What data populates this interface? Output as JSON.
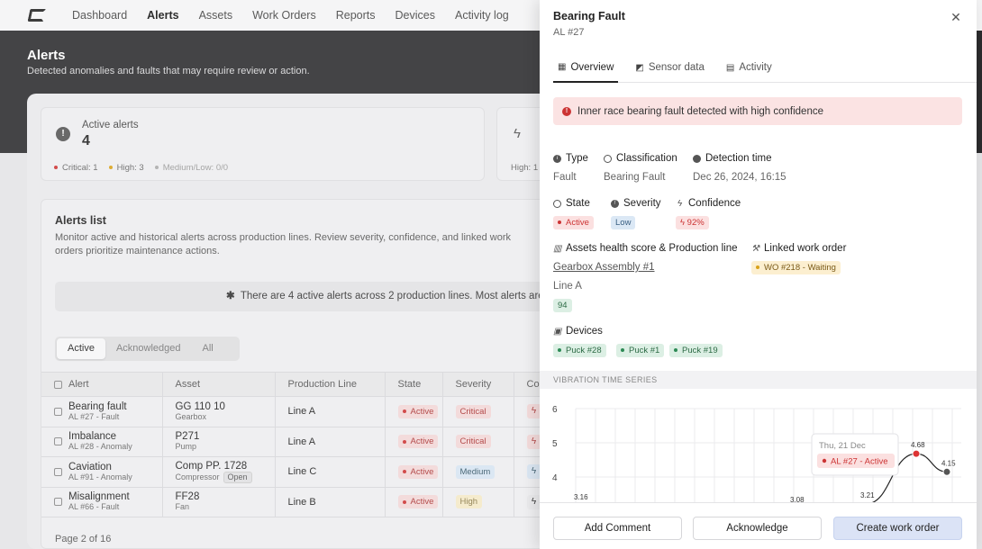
{
  "nav": {
    "items": [
      "Dashboard",
      "Alerts",
      "Assets",
      "Work Orders",
      "Reports",
      "Devices",
      "Activity log"
    ],
    "active": "Alerts"
  },
  "hero": {
    "title": "Alerts",
    "subtitle": "Detected anomalies and faults that may require review or action."
  },
  "stats": {
    "active_alerts": {
      "label": "Active alerts",
      "value": "4",
      "critical": "Critical: 1",
      "high": "High: 3",
      "medium_low": "Medium/Low: 0/0"
    },
    "second": {
      "text": "High: 1"
    }
  },
  "alerts_list": {
    "title": "Alerts list",
    "description": "Monitor active and historical alerts across production lines. Review severity, confidence, and linked work orders prioritize maintenance actions.",
    "banner": "There are 4 active alerts across 2 production lines. Most alerts are",
    "filters": [
      "Active",
      "Acknowledged",
      "All"
    ],
    "columns": [
      "Alert",
      "Asset",
      "Production Line",
      "State",
      "Severity",
      "Cor"
    ],
    "rows": [
      {
        "alert": "Bearing fault",
        "alert_sub": "AL #27 - Fault",
        "asset": "GG 110 10",
        "asset_sub": "Gearbox",
        "line": "Line A",
        "state": "Active",
        "severity": "Critical",
        "sev_class": "b-red"
      },
      {
        "alert": "Imbalance",
        "alert_sub": "AL #28 - Anomaly",
        "asset": "P271",
        "asset_sub": "Pump",
        "line": "Line A",
        "state": "Active",
        "severity": "Critical",
        "sev_class": "b-red"
      },
      {
        "alert": "Caviation",
        "alert_sub": "AL #91 - Anomaly",
        "asset": "Comp PP. 1728",
        "asset_sub": "Compressor",
        "line": "Line C",
        "state": "Active",
        "severity": "Medium",
        "sev_class": "b-blue"
      },
      {
        "alert": "Misalignment",
        "alert_sub": "AL #66 - Fault",
        "asset": "FF28",
        "asset_sub": "Fan",
        "line": "Line B",
        "state": "Active",
        "severity": "High",
        "sev_class": "b-yellow"
      }
    ],
    "open_label": "Open",
    "pager": "Page 2 of 16"
  },
  "drawer": {
    "title": "Bearing Fault",
    "subtitle": "AL #27",
    "tabs": [
      "Overview",
      "Sensor data",
      "Activity"
    ],
    "alert_message": "Inner race bearing fault detected with high confidence",
    "type_label": "Type",
    "type_value": "Fault",
    "classification_label": "Classification",
    "classification_value": "Bearing Fault",
    "detection_label": "Detection time",
    "detection_value": "Dec 26, 2024, 16:15",
    "state_label": "State",
    "state_value": "Active",
    "severity_label": "Severity",
    "severity_value": "Low",
    "confidence_label": "Confidence",
    "confidence_value": "92%",
    "health_label": "Assets health score & Production line",
    "health_asset": "Gearbox Assembly #1",
    "health_line": "Line A",
    "health_score": "94",
    "wo_label": "Linked work order",
    "wo_value": "WO #218 - Waiting",
    "devices_label": "Devices",
    "devices": [
      "Puck #28",
      "Puck #1",
      "Puck #19"
    ],
    "ts_title": "VIBRATION TIME SERIES",
    "buttons": {
      "comment": "Add Comment",
      "ack": "Acknowledge",
      "create": "Create work order"
    }
  },
  "chart_data": {
    "type": "line",
    "title": "VIBRATION TIME SERIES",
    "y_ticks": [
      4,
      5,
      6
    ],
    "ylim": [
      3,
      6
    ],
    "points": [
      {
        "label": "3.16",
        "y": 3.16
      },
      {
        "label": "3.08",
        "y": 3.08
      },
      {
        "label": "3.21",
        "y": 3.21
      },
      {
        "label": "4.68",
        "y": 4.68
      },
      {
        "label": "4.15",
        "y": 4.15
      }
    ],
    "tooltip": {
      "date": "Thu, 21 Dec",
      "alert": "AL #27 - Active"
    },
    "grid": true
  }
}
